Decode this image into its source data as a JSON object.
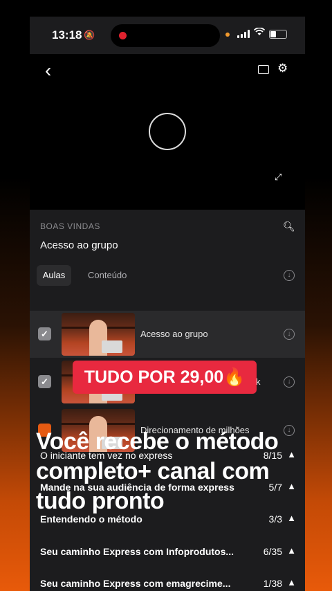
{
  "status": {
    "time": "13:18",
    "bell_icon": "bell-slash-icon",
    "wifi_icon": "wifi-icon",
    "battery_icon": "battery-icon"
  },
  "player": {
    "back_icon": "chevron-left-icon",
    "cast_icon": "airplay-icon",
    "settings_icon": "gear-icon",
    "fullscreen_icon": "expand-icon"
  },
  "course": {
    "module_label": "BOAS VINDAS",
    "current_lesson": "Acesso ao grupo",
    "tabs": [
      {
        "label": "Aulas",
        "selected": true
      },
      {
        "label": "Conteúdo",
        "selected": false
      }
    ],
    "lessons": [
      {
        "title": "Acesso ao grupo",
        "completed": true
      },
      {
        "title": "k",
        "completed": true
      },
      {
        "title": "Direcionamento de milhões",
        "completed": false
      }
    ],
    "sections": [
      {
        "name": "O iniciante tem vez no express",
        "count": "8/15"
      },
      {
        "name": "Mande na sua audiência de forma express",
        "count": "5/7"
      },
      {
        "name": "Entendendo o método",
        "count": "3/3"
      },
      {
        "name": "Seu caminho Express com Infoprodutos...",
        "count": "6/35"
      },
      {
        "name": "Seu caminho Express com emagrecime...",
        "count": "1/38"
      }
    ]
  },
  "overlay": {
    "promo": "TUDO POR 29,00🔥",
    "caption_lines": [
      "Você recebe o método",
      "completo+ canal com",
      "tudo pronto"
    ]
  },
  "colors": {
    "accent": "#e55a12",
    "promo": "#e8293f",
    "panel": "#1c1c1e"
  }
}
